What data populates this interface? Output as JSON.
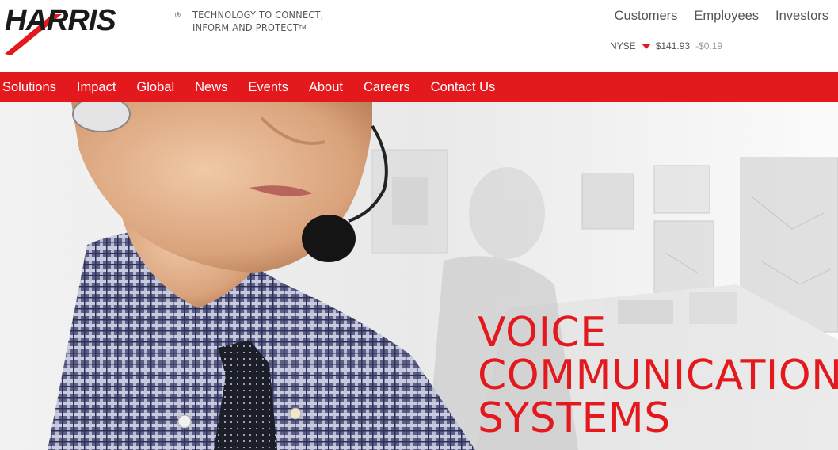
{
  "brand": {
    "logo_text": "HARRIS",
    "registered_mark": "®",
    "tagline_line1": "TECHNOLOGY TO CONNECT,",
    "tagline_line2": "INFORM AND PROTECT",
    "tagline_tm": "TM"
  },
  "top_links": [
    "Customers",
    "Employees",
    "Investors"
  ],
  "stock": {
    "exchange": "NYSE",
    "direction": "down",
    "price": "$141.93",
    "change": "-$0.19"
  },
  "nav": [
    "Solutions",
    "Impact",
    "Global",
    "News",
    "Events",
    "About",
    "Careers",
    "Contact Us"
  ],
  "hero": {
    "title_lines": [
      "VOICE",
      "COMMUNICATION",
      "SYSTEMS"
    ]
  },
  "colors": {
    "brand_red": "#e3191d",
    "text_gray": "#555555",
    "muted_gray": "#9a9a9a"
  },
  "icons": {
    "stock_arrow": "triangle-down-icon",
    "logo_swoosh": "harris-logo-icon"
  }
}
